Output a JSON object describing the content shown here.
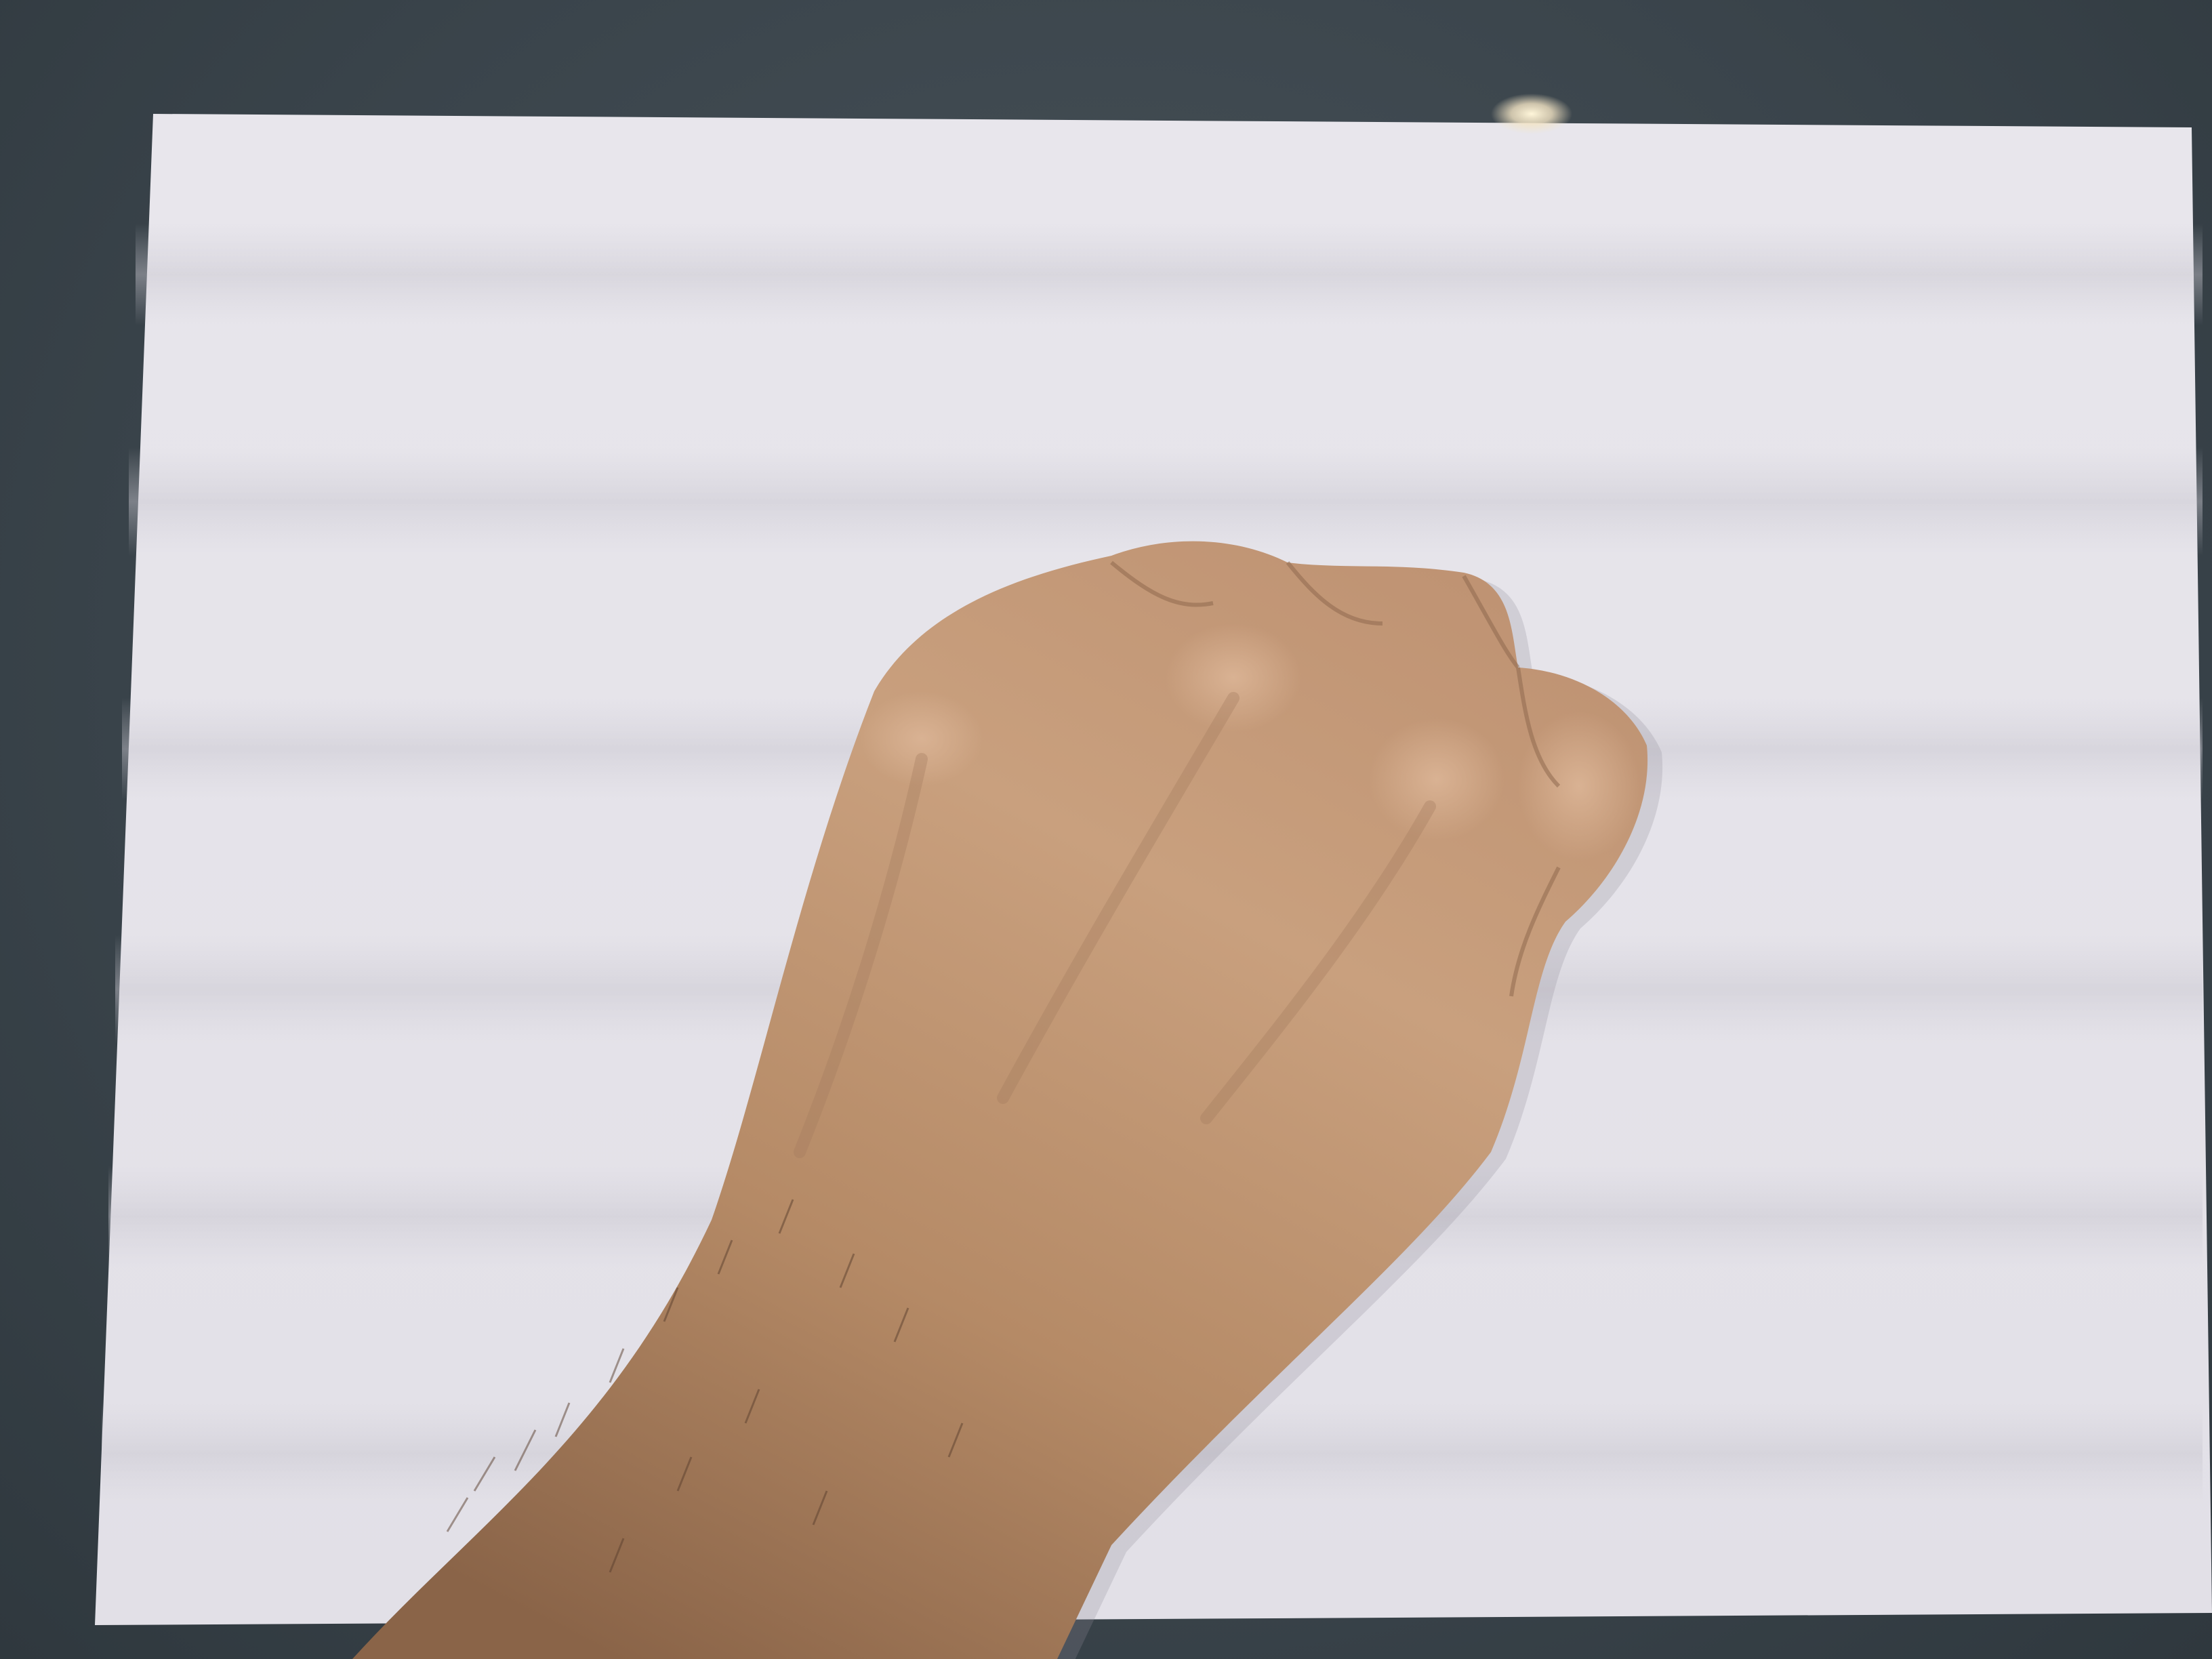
{
  "scene": {
    "subject": "hand-fist",
    "background": "paper-sheet-on-dark-surface",
    "colors": {
      "surface": "#3f4950",
      "paper": "#e6e4ea",
      "paper_shadow_band": "#cfcdd6",
      "skin_light": "#c9a07e",
      "skin_mid": "#b88d6a",
      "skin_dark": "#8f6a4f",
      "light_glare": "#f3e4c4"
    }
  }
}
